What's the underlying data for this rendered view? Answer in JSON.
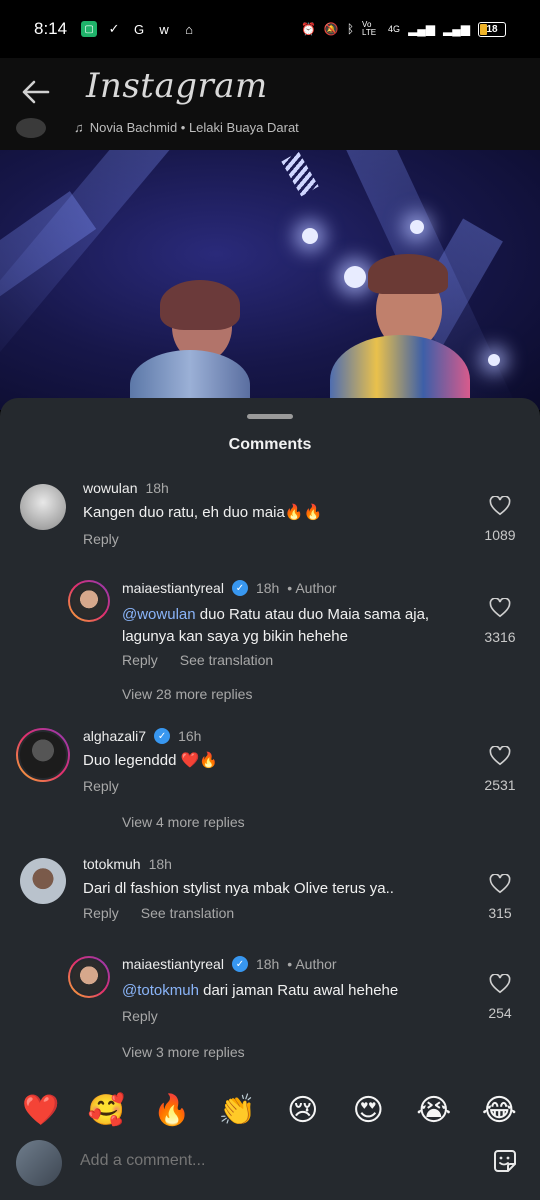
{
  "status_bar": {
    "time": "8:14",
    "battery": "18",
    "network": "4G",
    "volte": "Vo LTE"
  },
  "app": {
    "logo": "Instagram",
    "audio": "Novia Bachmid • Lelaki Buaya Darat"
  },
  "sheet": {
    "title": "Comments"
  },
  "comments": [
    {
      "user": "wowulan",
      "time": "18h",
      "text": "Kangen duo ratu, eh duo maia🔥🔥",
      "reply_label": "Reply",
      "likes": "1089"
    },
    {
      "user": "maiaestiantyreal",
      "time": "18h",
      "author_label": "• Author",
      "mention": "@wowulan",
      "text": " duo Ratu atau duo Maia sama aja, lagunya kan saya yg bikin hehehe",
      "reply_label": "Reply",
      "translate_label": "See translation",
      "likes": "3316"
    },
    {
      "user": "alghazali7",
      "time": "16h",
      "text": "Duo legenddd ❤️🔥",
      "reply_label": "Reply",
      "likes": "2531"
    },
    {
      "user": "totokmuh",
      "time": "18h",
      "text": "Dari dl fashion stylist nya mbak Olive terus ya..",
      "reply_label": "Reply",
      "translate_label": "See translation",
      "likes": "315"
    },
    {
      "user": "maiaestiantyreal",
      "time": "18h",
      "author_label": "• Author",
      "mention": "@totokmuh",
      "text": " dari jaman Ratu awal hehehe",
      "reply_label": "Reply",
      "likes": "254"
    }
  ],
  "more_replies": [
    "View 28 more replies",
    "View 4 more replies",
    "View 3 more replies"
  ],
  "emojis": [
    "❤️",
    "🥰",
    "🔥",
    "👏",
    "😢",
    "😍",
    "😭",
    "😂"
  ],
  "input": {
    "placeholder": "Add a comment..."
  }
}
